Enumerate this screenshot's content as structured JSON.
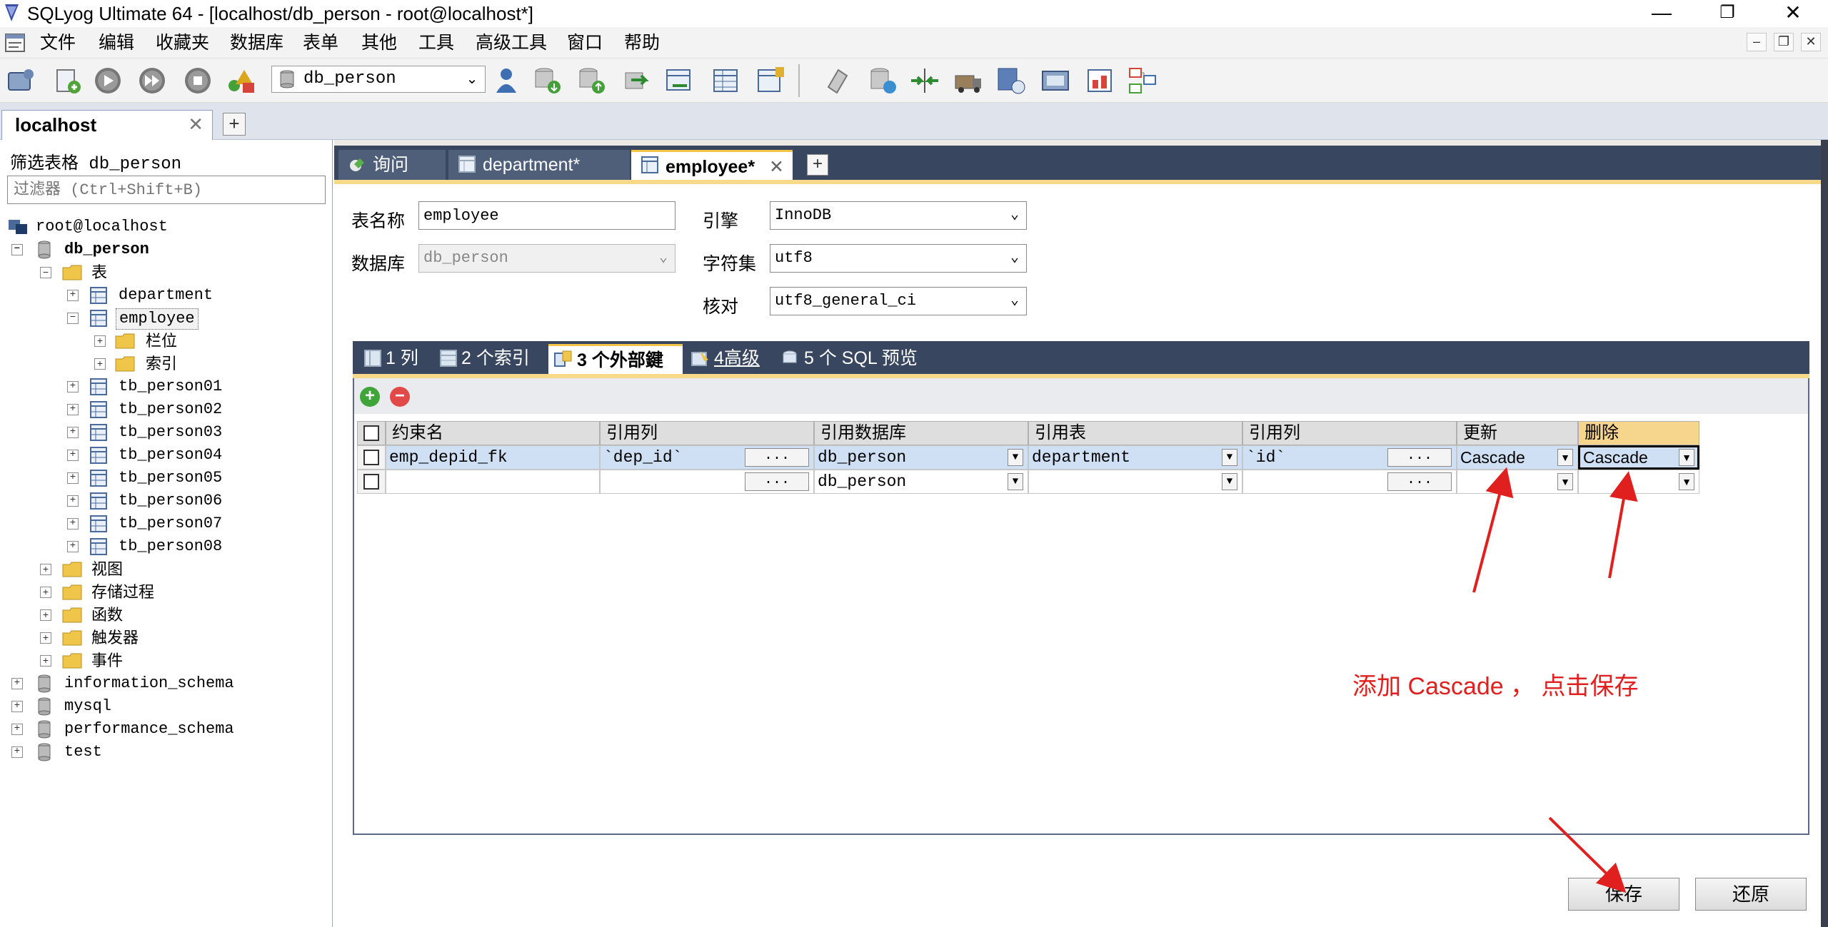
{
  "window": {
    "title": "SQLyog Ultimate 64 - [localhost/db_person - root@localhost*]",
    "controls": [
      "—",
      "❐",
      "✕"
    ]
  },
  "menu": {
    "items": [
      "文件",
      "编辑",
      "收藏夹",
      "数据库",
      "表单",
      "其他",
      "工具",
      "高级工具",
      "窗口",
      "帮助"
    ],
    "mdi_controls": [
      "–",
      "❐",
      "✕"
    ]
  },
  "toolbar": {
    "database_selector": "db_person"
  },
  "connection_tab": {
    "label": "localhost",
    "close": "✕",
    "add": "+"
  },
  "object_browser": {
    "filter_label": "筛选表格 db_person",
    "filter_placeholder": "过滤器 (Ctrl+Shift+B)",
    "tree": {
      "root": "root@localhost",
      "db": "db_person",
      "tables_folder": "表",
      "department": "department",
      "employee": "employee",
      "columns_folder": "栏位",
      "indexes_folder": "索引",
      "tables": [
        "tb_person01",
        "tb_person02",
        "tb_person03",
        "tb_person04",
        "tb_person05",
        "tb_person06",
        "tb_person07",
        "tb_person08"
      ],
      "db_folders": [
        "视图",
        "存储过程",
        "函数",
        "触发器",
        "事件"
      ],
      "other_dbs": [
        "information_schema",
        "mysql",
        "performance_schema",
        "test"
      ]
    }
  },
  "query_tabs": [
    {
      "label": "询问"
    },
    {
      "label": "department*"
    },
    {
      "label": "employee*",
      "active": true,
      "close": "✕"
    }
  ],
  "query_tab_add": "+",
  "table_form": {
    "table_name_label": "表名称",
    "table_name": "employee",
    "database_label": "数据库",
    "database": "db_person",
    "engine_label": "引擎",
    "engine": "InnoDB",
    "charset_label": "字符集",
    "charset": "utf8",
    "collation_label": "核对",
    "collation": "utf8_general_ci"
  },
  "sub_tabs": [
    {
      "label": "1 列"
    },
    {
      "label": "2 个索引"
    },
    {
      "label": "3 个外部鍵",
      "active": true
    },
    {
      "label": "4高级"
    },
    {
      "label": "5 个 SQL 预览"
    }
  ],
  "fk_grid": {
    "add_symbol": "+",
    "remove_symbol": "−",
    "headers": [
      "约束名",
      "引用列",
      "引用数据库",
      "引用表",
      "引用列",
      "更新",
      "删除"
    ],
    "rows": [
      {
        "name": "emp_depid_fk",
        "column": "`dep_id`",
        "ref_db": "db_person",
        "ref_table": "department",
        "ref_column": "`id`",
        "on_update": "Cascade",
        "on_delete": "Cascade"
      },
      {
        "name": "",
        "column": "",
        "ref_db": "db_person",
        "ref_table": "",
        "ref_column": "",
        "on_update": "",
        "on_delete": ""
      }
    ],
    "ellipsis": "..."
  },
  "annotation": {
    "text": "添加 Cascade ， 点击保存"
  },
  "buttons": {
    "save": "保存",
    "revert": "还原"
  },
  "colors": {
    "tab_bar": "#38475f",
    "accent": "#f7d989",
    "annotation": "#e0201e",
    "selected_row": "#cfe0f5"
  }
}
